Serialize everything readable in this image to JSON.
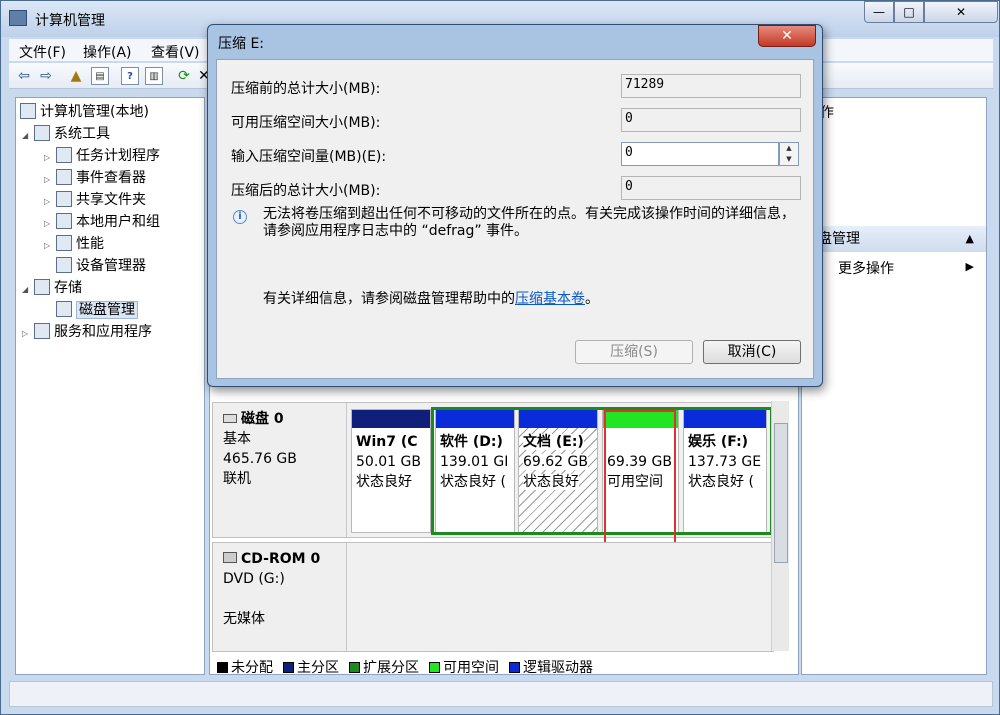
{
  "window": {
    "title": "计算机管理",
    "controls": {
      "min": "—",
      "max": "□",
      "close": "✕"
    }
  },
  "menu": [
    "文件(F)",
    "操作(A)",
    "查看(V)"
  ],
  "tree": [
    {
      "label": "计算机管理(本地)",
      "icon": "computer-icon"
    },
    {
      "label": "系统工具",
      "icon": "tools-icon"
    },
    {
      "label": "任务计划程序",
      "icon": "clock-icon"
    },
    {
      "label": "事件查看器",
      "icon": "event-viewer-icon"
    },
    {
      "label": "共享文件夹",
      "icon": "shared-folder-icon"
    },
    {
      "label": "本地用户和组",
      "icon": "users-icon"
    },
    {
      "label": "性能",
      "icon": "performance-icon"
    },
    {
      "label": "设备管理器",
      "icon": "device-manager-icon"
    },
    {
      "label": "存储",
      "icon": "storage-icon"
    },
    {
      "label": "磁盘管理",
      "icon": "disk-management-icon"
    },
    {
      "label": "服务和应用程序",
      "icon": "services-icon"
    }
  ],
  "actions": {
    "header": "作",
    "group": "盘管理",
    "more": "更多操作"
  },
  "disk0": {
    "name": "磁盘 0",
    "type": "基本",
    "size": "465.76 GB",
    "status": "联机",
    "partitions": [
      {
        "name": "Win7  (C",
        "size": "50.01 GB",
        "status": "状态良好",
        "band": "#10207a"
      },
      {
        "name": "软件  (D:)",
        "size": "139.01 GI",
        "status": "状态良好 (",
        "band": "#0a2bd8"
      },
      {
        "name": "文档  (E:)",
        "size": "69.62 GB",
        "status": "状态良好",
        "band": "#0a2bd8"
      },
      {
        "name": "",
        "size": "69.39 GB",
        "status": "可用空间",
        "band": "#22e622"
      },
      {
        "name": "娱乐  (F:)",
        "size": "137.73 GE",
        "status": "状态良好 (",
        "band": "#0a2bd8"
      }
    ]
  },
  "cdrom": {
    "name": "CD-ROM 0",
    "drive": "DVD (G:)",
    "media": "无媒体"
  },
  "legend": [
    {
      "label": "未分配",
      "color": "#000000"
    },
    {
      "label": "主分区",
      "color": "#10207a"
    },
    {
      "label": "扩展分区",
      "color": "#1d8a1d"
    },
    {
      "label": "可用空间",
      "color": "#22e622"
    },
    {
      "label": "逻辑驱动器",
      "color": "#0a2bd8"
    }
  ],
  "dialog": {
    "title": "压缩 E:",
    "close": "✕",
    "fields": [
      {
        "label": "压缩前的总计大小(MB):",
        "value": "71289"
      },
      {
        "label": "可用压缩空间大小(MB):",
        "value": "0"
      },
      {
        "label": "输入压缩空间量(MB)(E):",
        "value": "0"
      },
      {
        "label": "压缩后的总计大小(MB):",
        "value": "0"
      }
    ],
    "info": "无法将卷压缩到超出任何不可移动的文件所在的点。有关完成该操作时间的详细信息，请参阅应用程序日志中的 “defrag” 事件。",
    "help_prefix": "有关详细信息，请参阅磁盘管理帮助中的",
    "help_link": "压缩基本卷",
    "help_suffix": "。",
    "shrink_button": "压缩(S)",
    "cancel_button": "取消(C)"
  }
}
